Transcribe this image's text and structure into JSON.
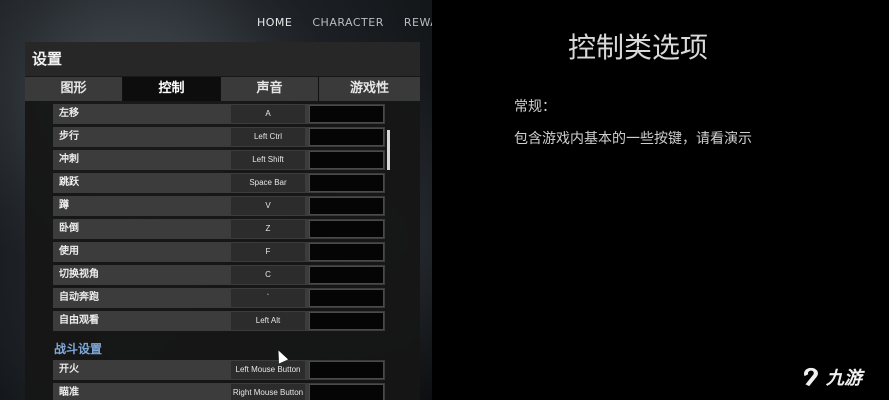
{
  "topnav": {
    "items": [
      "HOME",
      "CHARACTER",
      "REWA"
    ]
  },
  "settings": {
    "title": "设置",
    "tabs": [
      {
        "label": "图形",
        "active": false
      },
      {
        "label": "控制",
        "active": true
      },
      {
        "label": "声音",
        "active": false
      },
      {
        "label": "游戏性",
        "active": false
      }
    ],
    "bindings": [
      {
        "action": "左移",
        "key": "A"
      },
      {
        "action": "步行",
        "key": "Left Ctrl"
      },
      {
        "action": "冲刺",
        "key": "Left Shift"
      },
      {
        "action": "跳跃",
        "key": "Space Bar"
      },
      {
        "action": "蹲",
        "key": "V"
      },
      {
        "action": "卧倒",
        "key": "Z"
      },
      {
        "action": "使用",
        "key": "F"
      },
      {
        "action": "切换视角",
        "key": "C"
      },
      {
        "action": "自动奔跑",
        "key": "`"
      },
      {
        "action": "自由观看",
        "key": "Left Alt"
      }
    ],
    "combat_section": "战斗设置",
    "combat_bindings": [
      {
        "action": "开火",
        "key": "Left Mouse Button"
      },
      {
        "action": "瞄准",
        "key": "Right Mouse Button"
      }
    ]
  },
  "explanation": {
    "title": "控制类选项",
    "section_head": "常规：",
    "section_desc": "包含游戏内基本的一些按键，请看演示"
  },
  "watermark": {
    "text": "九游",
    "icon": "jiuyou-logo-icon"
  },
  "colors": {
    "section_label": "#7fa8d6",
    "active_tab": "#0d0d0d",
    "tab": "#3a3a3a"
  }
}
